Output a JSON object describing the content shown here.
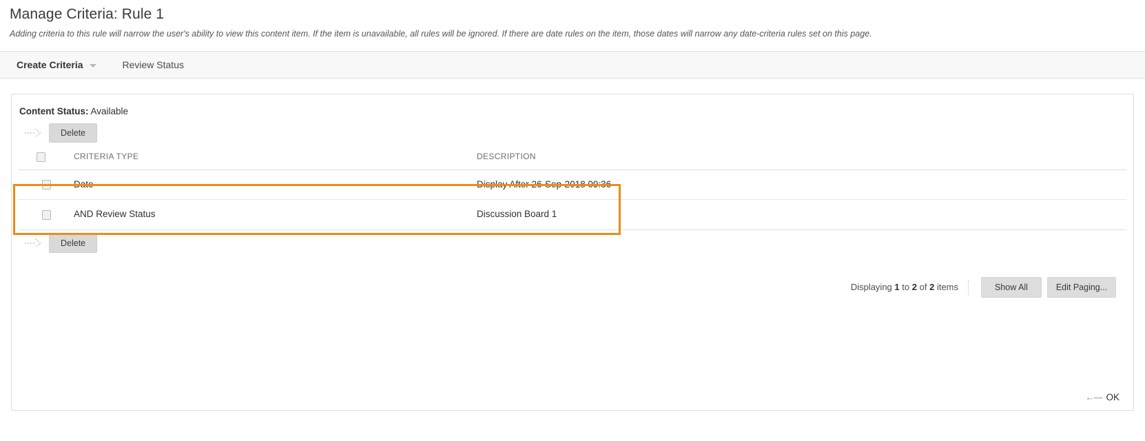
{
  "header": {
    "title": "Manage Criteria: Rule 1",
    "subtitle": "Adding criteria to this rule will narrow the user's ability to view this content item. If the item is unavailable, all rules will be ignored. If there are date rules on the item, those dates will narrow any date-criteria rules set on this page."
  },
  "action_bar": {
    "create_criteria_label": "Create Criteria",
    "review_status_label": "Review Status",
    "chevron_icon": "chevron-down-icon"
  },
  "panel": {
    "content_status_label": "Content Status:",
    "content_status_value": "Available",
    "delete_top_label": "Delete",
    "delete_bottom_label": "Delete",
    "arrow_hint_icon": "dashed-arrow-right-icon",
    "table": {
      "columns": [
        "CRITERIA TYPE",
        "DESCRIPTION"
      ],
      "rows": [
        {
          "criteria_type": "Date",
          "description": "Display After 26-Sep-2018 09:36"
        },
        {
          "criteria_type": "AND Review Status",
          "description": "Discussion Board 1"
        }
      ]
    },
    "paging": {
      "prefix": "Displaying",
      "from": "1",
      "mid": "to",
      "to": "2",
      "of": "of",
      "total": "2",
      "suffix": "items",
      "show_all_label": "Show All",
      "edit_paging_label": "Edit Paging..."
    },
    "footer": {
      "ok_label": "OK",
      "back_arrow_glyph": "←—"
    },
    "highlight_color": "#ef8b17"
  }
}
